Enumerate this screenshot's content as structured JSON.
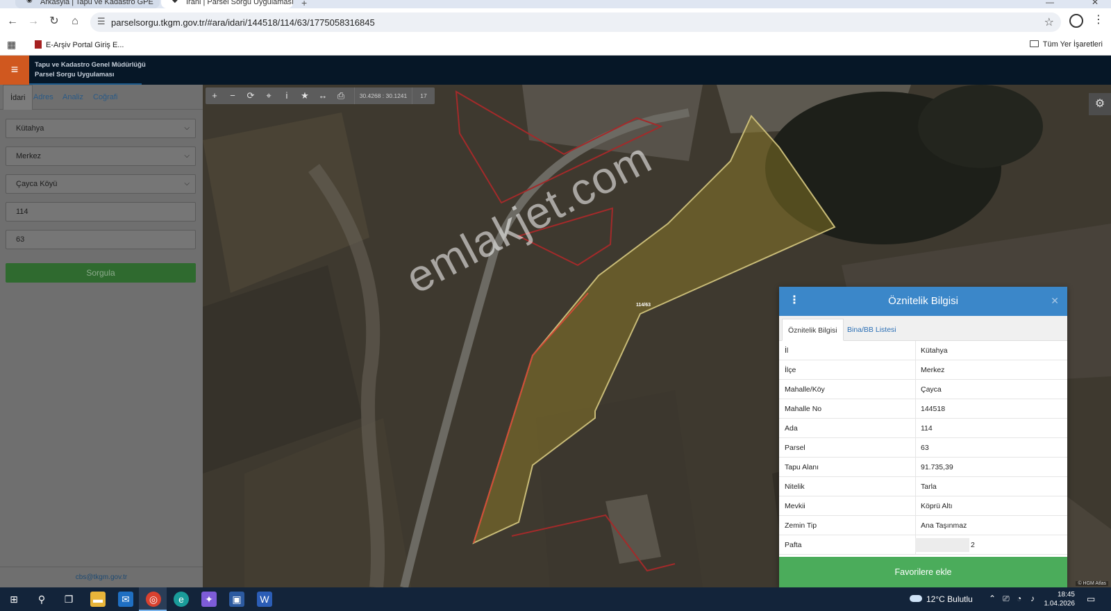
{
  "browser": {
    "tabs": [
      {
        "label": "Arkasyla | Tapu ve Kadastro GPE"
      },
      {
        "label": "Irani | Parsel Sorgu Uygulaması"
      }
    ],
    "url": "parselsorgu.tkgm.gov.tr/#ara/idari/144518/114/63/1775058316845",
    "bookmark": "E-Arşiv Portal Giriş E...",
    "all_bookmarks": "Tüm Yer İşaretleri"
  },
  "app": {
    "title_line1": "Tapu ve Kadastro Genel Müdürlüğü",
    "title_line2": "Parsel Sorgu Uygulaması"
  },
  "sidebar": {
    "tabs": [
      "İdari",
      "Adres",
      "Analiz",
      "Coğrafi"
    ],
    "province": "Kütahya",
    "district": "Merkez",
    "neighborhood": "Çayca Köyü",
    "block": "114",
    "parcel": "63",
    "query_button": "Sorgula",
    "footer_email": "cbs@tkgm.gov.tr"
  },
  "map": {
    "coords": "30.4268 : 30.1241",
    "zoom": "17",
    "parcel_label": "114/63",
    "watermark": "emlakjet.com",
    "attribution": "© HGM Atlas"
  },
  "panel": {
    "title": "Öznitelik Bilgisi",
    "tabs": [
      "Öznitelik Bilgisi",
      "Bina/BB Listesi"
    ],
    "rows": [
      {
        "key": "İl",
        "value": "Kütahya"
      },
      {
        "key": "İlçe",
        "value": "Merkez"
      },
      {
        "key": "Mahalle/Köy",
        "value": "Çayca"
      },
      {
        "key": "Mahalle No",
        "value": "144518"
      },
      {
        "key": "Ada",
        "value": "114"
      },
      {
        "key": "Parsel",
        "value": "63"
      },
      {
        "key": "Tapu Alanı",
        "value": "91.735,39"
      },
      {
        "key": "Nitelik",
        "value": "Tarla"
      },
      {
        "key": "Mevkii",
        "value": "Köprü Altı"
      },
      {
        "key": "Zemin Tip",
        "value": "Ana Taşınmaz"
      },
      {
        "key": "Pafta",
        "value": "2"
      }
    ],
    "favorite_button": "Favorilere ekle"
  },
  "taskbar": {
    "weather": "12°C  Bulutlu",
    "time": "18:45",
    "date": "1.04.2026"
  },
  "colors": {
    "header": "#061727",
    "accent": "#d0581f",
    "panel_head": "#3b87c9",
    "favorite": "#4bac5b",
    "query": "#2f6a2f"
  }
}
